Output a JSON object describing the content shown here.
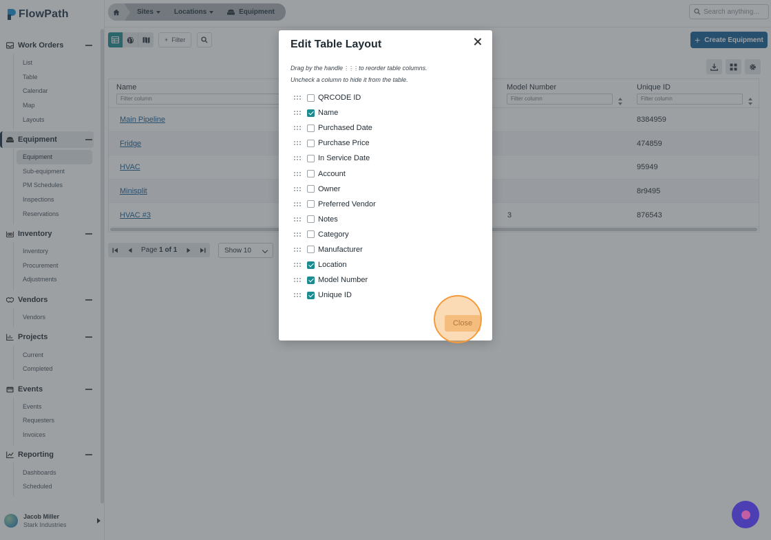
{
  "app": {
    "name": "FlowPath"
  },
  "breadcrumb": {
    "sites": "Sites",
    "locations": "Locations",
    "current": "Equipment"
  },
  "search": {
    "placeholder": "Search anything..."
  },
  "sidebar": {
    "groups": [
      {
        "label": "Work Orders",
        "items": [
          "List",
          "Table",
          "Calendar",
          "Map",
          "Layouts"
        ]
      },
      {
        "label": "Equipment",
        "items": [
          "Equipment",
          "Sub-equipment",
          "PM Schedules",
          "Inspections",
          "Reservations"
        ]
      },
      {
        "label": "Inventory",
        "items": [
          "Inventory",
          "Procurement",
          "Adjustments"
        ]
      },
      {
        "label": "Vendors",
        "items": [
          "Vendors"
        ]
      },
      {
        "label": "Projects",
        "items": [
          "Current",
          "Completed"
        ]
      },
      {
        "label": "Events",
        "items": [
          "Events",
          "Requesters",
          "Invoices"
        ]
      },
      {
        "label": "Reporting",
        "items": [
          "Dashboards",
          "Scheduled"
        ]
      }
    ],
    "user": {
      "name": "Jacob Miller",
      "org": "Stark Industries"
    }
  },
  "toolbar": {
    "filter_label": "Filter",
    "create_label": "Create Equipment"
  },
  "table": {
    "columns": [
      {
        "label": "Name",
        "filter_placeholder": "Filter column"
      },
      {
        "label": "Model Number",
        "filter_placeholder": "Filter column"
      },
      {
        "label": "Unique ID",
        "filter_placeholder": "Filter column"
      }
    ],
    "rows": [
      {
        "name": "Main Pipeline",
        "model": "",
        "uid": "8384959"
      },
      {
        "name": "Fridge",
        "model": "",
        "uid": "474859"
      },
      {
        "name": "HVAC",
        "model": "",
        "uid": "95949"
      },
      {
        "name": "Minisplit",
        "model": "",
        "uid": "8r9495"
      },
      {
        "name": "HVAC #3",
        "model": "3",
        "uid": "876543"
      }
    ]
  },
  "pagination": {
    "page_prefix": "Page",
    "current": "1",
    "of_word": "of",
    "total": "1",
    "show_label": "Show 10"
  },
  "modal": {
    "title": "Edit Table Layout",
    "hint_line1_a": "Drag by the handle",
    "hint_line1_b": "to reorder table columns.",
    "hint_line2": "Uncheck a column to hide it from the table.",
    "columns": [
      {
        "label": "QRCODE ID",
        "checked": false
      },
      {
        "label": "Name",
        "checked": true
      },
      {
        "label": "Purchased Date",
        "checked": false
      },
      {
        "label": "Purchase Price",
        "checked": false
      },
      {
        "label": "In Service Date",
        "checked": false
      },
      {
        "label": "Account",
        "checked": false
      },
      {
        "label": "Owner",
        "checked": false
      },
      {
        "label": "Preferred Vendor",
        "checked": false
      },
      {
        "label": "Notes",
        "checked": false
      },
      {
        "label": "Category",
        "checked": false
      },
      {
        "label": "Manufacturer",
        "checked": false
      },
      {
        "label": "Location",
        "checked": true
      },
      {
        "label": "Model Number",
        "checked": true
      },
      {
        "label": "Unique ID",
        "checked": true
      }
    ],
    "close_label": "Close"
  },
  "colors": {
    "primary": "#135c94",
    "accent": "#1b8b92",
    "highlight": "#f39b3a"
  }
}
